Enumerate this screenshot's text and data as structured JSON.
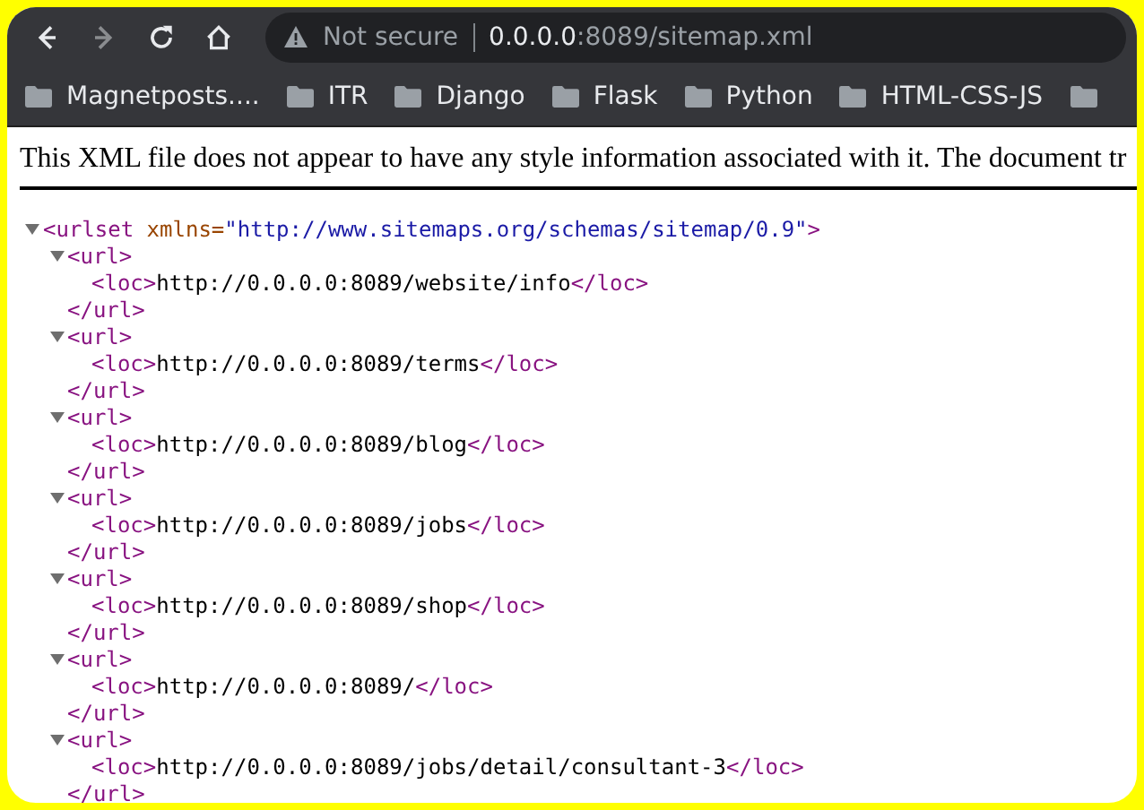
{
  "toolbar": {
    "nav_buttons": [
      {
        "kind": "back",
        "disabled": false
      },
      {
        "kind": "forward",
        "disabled": true
      },
      {
        "kind": "reload",
        "disabled": false
      },
      {
        "kind": "home",
        "disabled": false
      }
    ],
    "address_bar": {
      "security": "Not secure",
      "host": "0.0.0.0",
      "path": ":8089/sitemap.xml"
    }
  },
  "bookmarks": [
    {
      "kind": "folder",
      "label": "Magnetposts...."
    },
    {
      "kind": "folder",
      "label": "ITR"
    },
    {
      "kind": "folder",
      "label": "Django"
    },
    {
      "kind": "folder",
      "label": "Flask"
    },
    {
      "kind": "folder",
      "label": "Python"
    },
    {
      "kind": "folder",
      "label": "HTML-CSS-JS"
    },
    {
      "kind": "folder"
    }
  ],
  "notice": "This XML file does not appear to have any style information associated with it. The document tr",
  "xml_tree": [
    {
      "expanded": true,
      "open": [
        {
          "kind": "tag",
          "text": "<urlset"
        },
        {
          "kind": "attr",
          "text": " xmlns="
        },
        {
          "kind": "value",
          "text": "\"http://www.sitemaps.org/schemas/sitemap/0.9\""
        },
        {
          "kind": "tag",
          "text": ">"
        }
      ],
      "children": [
        {
          "expanded": true,
          "open": [
            {
              "kind": "tag",
              "text": "<url>"
            }
          ],
          "close": "</url>",
          "children": [
            {
              "open": [
                {
                  "kind": "tag",
                  "text": "<loc>"
                },
                {
                  "kind": "text",
                  "text": "http://0.0.0.0:8089/website/info"
                },
                {
                  "kind": "tag",
                  "text": "</loc>"
                }
              ]
            }
          ]
        },
        {
          "expanded": true,
          "open": [
            {
              "kind": "tag",
              "text": "<url>"
            }
          ],
          "close": "</url>",
          "children": [
            {
              "open": [
                {
                  "kind": "tag",
                  "text": "<loc>"
                },
                {
                  "kind": "text",
                  "text": "http://0.0.0.0:8089/terms"
                },
                {
                  "kind": "tag",
                  "text": "</loc>"
                }
              ]
            }
          ]
        },
        {
          "expanded": true,
          "open": [
            {
              "kind": "tag",
              "text": "<url>"
            }
          ],
          "close": "</url>",
          "children": [
            {
              "open": [
                {
                  "kind": "tag",
                  "text": "<loc>"
                },
                {
                  "kind": "text",
                  "text": "http://0.0.0.0:8089/blog"
                },
                {
                  "kind": "tag",
                  "text": "</loc>"
                }
              ]
            }
          ]
        },
        {
          "expanded": true,
          "open": [
            {
              "kind": "tag",
              "text": "<url>"
            }
          ],
          "close": "</url>",
          "children": [
            {
              "open": [
                {
                  "kind": "tag",
                  "text": "<loc>"
                },
                {
                  "kind": "text",
                  "text": "http://0.0.0.0:8089/jobs"
                },
                {
                  "kind": "tag",
                  "text": "</loc>"
                }
              ]
            }
          ]
        },
        {
          "expanded": true,
          "open": [
            {
              "kind": "tag",
              "text": "<url>"
            }
          ],
          "close": "</url>",
          "children": [
            {
              "open": [
                {
                  "kind": "tag",
                  "text": "<loc>"
                },
                {
                  "kind": "text",
                  "text": "http://0.0.0.0:8089/shop"
                },
                {
                  "kind": "tag",
                  "text": "</loc>"
                }
              ]
            }
          ]
        },
        {
          "expanded": true,
          "open": [
            {
              "kind": "tag",
              "text": "<url>"
            }
          ],
          "close": "</url>",
          "children": [
            {
              "open": [
                {
                  "kind": "tag",
                  "text": "<loc>"
                },
                {
                  "kind": "text",
                  "text": "http://0.0.0.0:8089/"
                },
                {
                  "kind": "tag",
                  "text": "</loc>"
                }
              ]
            }
          ]
        },
        {
          "expanded": true,
          "open": [
            {
              "kind": "tag",
              "text": "<url>"
            }
          ],
          "close": "</url>",
          "children": [
            {
              "open": [
                {
                  "kind": "tag",
                  "text": "<loc>"
                },
                {
                  "kind": "text",
                  "text": "http://0.0.0.0:8089/jobs/detail/consultant-3"
                },
                {
                  "kind": "tag",
                  "text": "</loc>"
                }
              ]
            }
          ]
        }
      ]
    }
  ]
}
